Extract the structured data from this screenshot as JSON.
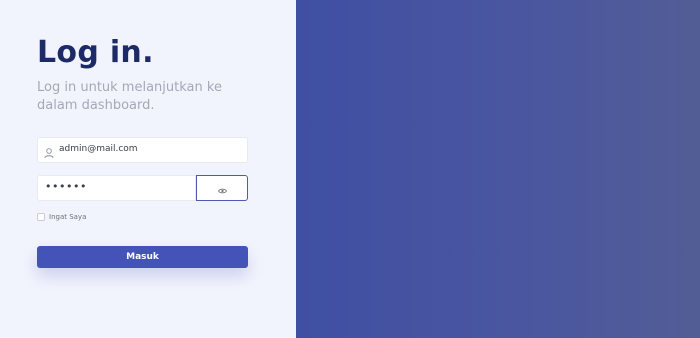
{
  "login": {
    "title": "Log in.",
    "subtitle": "Log in untuk melanjutkan ke dalam dashboard.",
    "email": {
      "value": "admin@mail.com",
      "icon": "user-icon"
    },
    "password": {
      "value": "••••••",
      "toggle_icon": "eye-icon"
    },
    "remember_label": "Ingat Saya",
    "submit_label": "Masuk"
  },
  "colors": {
    "title": "#1c2a68",
    "accent": "#4353b7",
    "left_bg": "#f2f4fd",
    "right_bg_start": "#3f4fa2",
    "right_bg_end": "#525d96"
  }
}
